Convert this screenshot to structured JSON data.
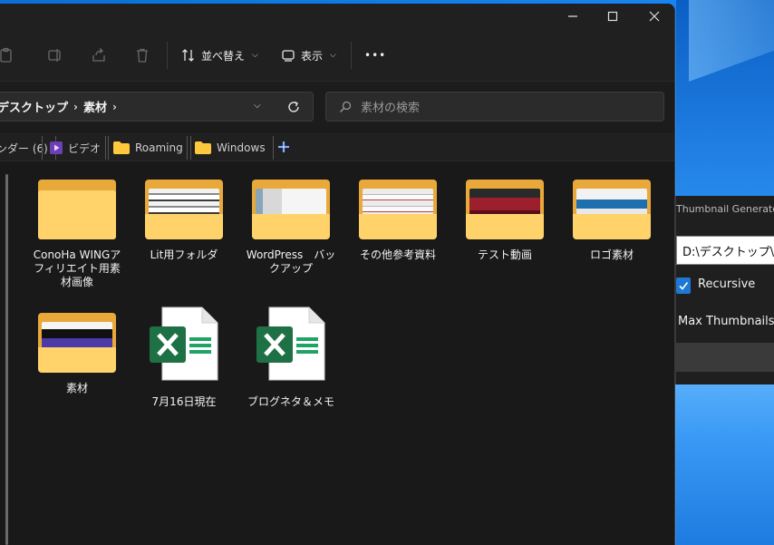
{
  "toolbar": {
    "sort_label": "並べ替え",
    "view_label": "表示",
    "more_label": "•••"
  },
  "address": {
    "crumbs": [
      "デスクトップ",
      "素材"
    ],
    "search_placeholder": "素材の検索"
  },
  "tabs": [
    {
      "label": "ンダー (6)"
    },
    {
      "label": "ビデオ"
    },
    {
      "label": "Roaming"
    },
    {
      "label": "Windows"
    }
  ],
  "items": [
    {
      "label": "ConoHa WINGアフィリエイト用素材画像",
      "kind": "folder"
    },
    {
      "label": "Lit用フォルダ",
      "kind": "folder-thumb"
    },
    {
      "label": "WordPress　バックアップ",
      "kind": "folder-thumb"
    },
    {
      "label": "その他参考資料",
      "kind": "folder-thumb"
    },
    {
      "label": "テスト動画",
      "kind": "folder-thumb"
    },
    {
      "label": "ロゴ素材",
      "kind": "folder-thumb"
    },
    {
      "label": "素材",
      "kind": "folder-thumb"
    },
    {
      "label": "7月16日現在",
      "kind": "xlsx"
    },
    {
      "label": "ブログネタ＆メモ",
      "kind": "xlsx"
    }
  ],
  "thumbgen": {
    "title": "Thumbnail Generator",
    "path": "D:\\デスクトップ\\素材",
    "recursive_label": "Recursive",
    "recursive_checked": true,
    "max_label": "Max Thumbnails:"
  },
  "colors": {
    "folder_front": "#ffd36a",
    "folder_back": "#e8a93a",
    "excel_green": "#1e7145",
    "accent": "#1e78d4"
  }
}
